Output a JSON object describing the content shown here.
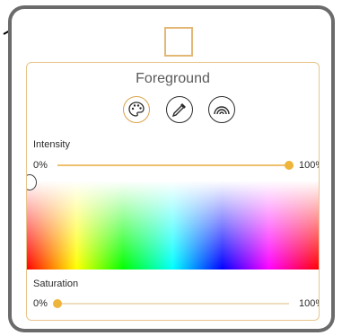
{
  "picker": {
    "title": "Foreground",
    "modes": [
      {
        "name": "palette",
        "active": true
      },
      {
        "name": "eyedropper",
        "active": false
      },
      {
        "name": "rainbow",
        "active": false
      }
    ],
    "intensity": {
      "label": "Intensity",
      "min_label": "0%",
      "max_label": "100%",
      "value_percent": 100
    },
    "saturation": {
      "label": "Saturation",
      "min_label": "0%",
      "max_label": "100%",
      "value_percent": 0
    },
    "colors": {
      "accent": "#efb43a",
      "panel_border": "#e9c58c",
      "frame": "#6b6b6b"
    }
  }
}
